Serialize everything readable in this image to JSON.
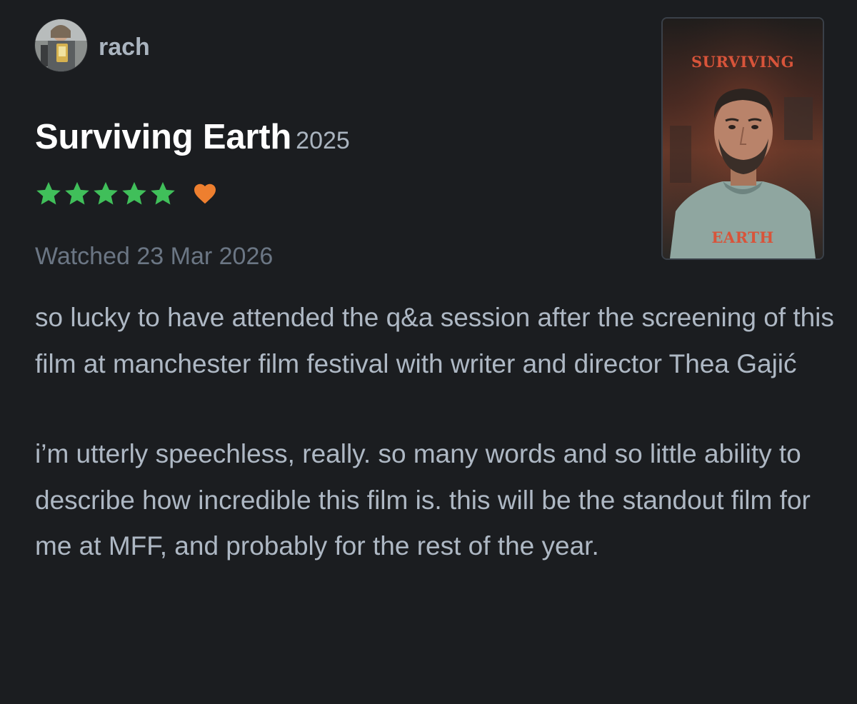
{
  "user": {
    "name": "rach",
    "avatar_icon": "user-avatar"
  },
  "film": {
    "title": "Surviving Earth",
    "year": "2025"
  },
  "rating": {
    "stars": 5,
    "max_stars": 5,
    "liked": true,
    "star_color": "#40bf5a",
    "heart_color": "#ee7f2f"
  },
  "watched": "Watched 23 Mar 2026",
  "review": {
    "paragraphs": [
      "so lucky to have attended the q&a session after the screening of this film at manchester film festival with writer and director Thea Gajić",
      "i’m utterly speechless, really. so many words and so little ability to describe how incredible this film is. this will be the standout film for me at MFF, and probably for the rest of the year."
    ]
  },
  "poster": {
    "title_top": "SURVIVING",
    "title_bottom": "EARTH",
    "title_color": "#d8543a"
  }
}
